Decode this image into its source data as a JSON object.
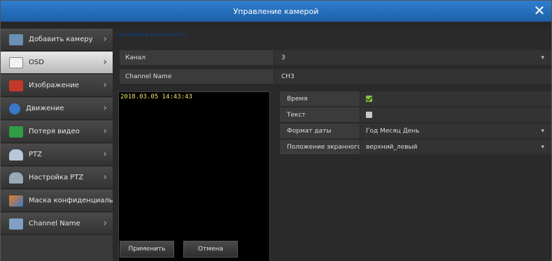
{
  "window": {
    "title": "Управление камерой",
    "close_icon": "close-icon"
  },
  "sidebar": {
    "items": [
      {
        "label": "Добавить камеру",
        "icon": "add-camera-icon",
        "color": "#6b8fb5"
      },
      {
        "label": "OSD",
        "icon": "osd-icon",
        "color": "#d9d9d9"
      },
      {
        "label": "Изображение",
        "icon": "image-icon",
        "color": "#c0392b"
      },
      {
        "label": "Движение",
        "icon": "motion-icon",
        "color": "#3a78c9"
      },
      {
        "label": "Потеря видео",
        "icon": "video-loss-icon",
        "color": "#2f9e44"
      },
      {
        "label": "PTZ",
        "icon": "ptz-icon",
        "color": "#b8c8d8"
      },
      {
        "label": "Настройка PTZ",
        "icon": "ptz-settings-icon",
        "color": "#9aa8b8"
      },
      {
        "label": "Маска конфиденциальности",
        "icon": "privacy-mask-icon",
        "color": "#e67e22"
      },
      {
        "label": "Channel Name",
        "icon": "channel-name-icon",
        "color": "#7fa0c0"
      }
    ]
  },
  "main": {
    "breadcrumb": "настройки экранного м",
    "channel": {
      "label": "Канал",
      "value": "3"
    },
    "channel_name": {
      "label": "Channel Name",
      "value": "CH3"
    },
    "preview": {
      "timestamp": "2018.03.05 14:43:43"
    },
    "options": {
      "time": {
        "label": "Время",
        "checked": true
      },
      "text": {
        "label": "Текст",
        "checked": false
      },
      "date_format": {
        "label": "Формат даты",
        "value": "Год Месяц День"
      },
      "osd_position": {
        "label": "Положение экранного",
        "value": "верхний_левый"
      }
    },
    "buttons": {
      "apply": "Применить",
      "cancel": "Отмена"
    }
  }
}
